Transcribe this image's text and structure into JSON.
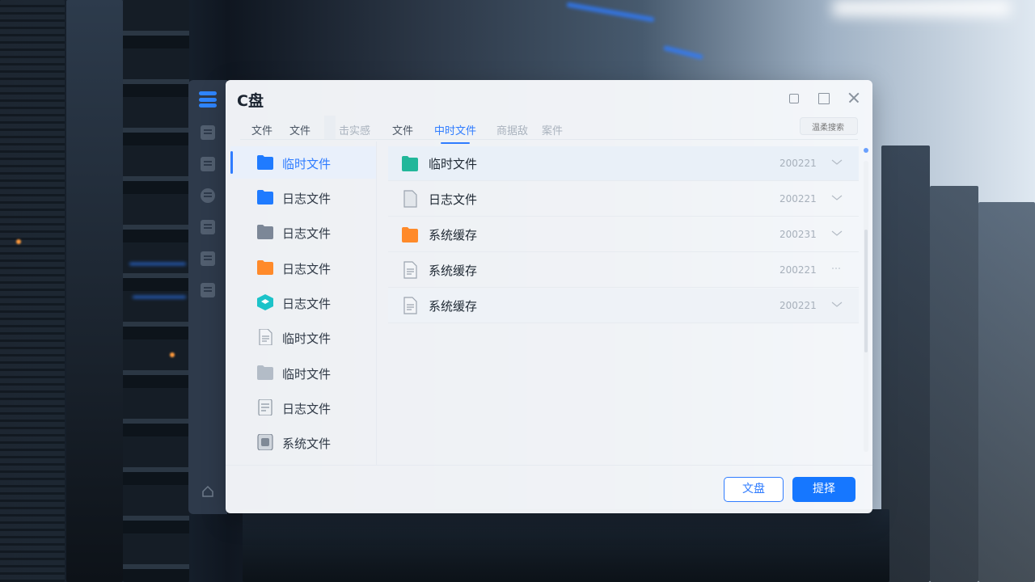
{
  "window": {
    "title": "C盘"
  },
  "tabs": [
    {
      "label": "文件",
      "state": "normal"
    },
    {
      "label": "文件",
      "state": "normal"
    },
    {
      "label": "击实感",
      "state": "muted"
    },
    {
      "label": "文件",
      "state": "normal"
    },
    {
      "label": "中时文件",
      "state": "active"
    },
    {
      "label": "商据敌",
      "state": "muted"
    },
    {
      "label": "案件",
      "state": "muted"
    }
  ],
  "search": {
    "placeholder": "温柔搜索"
  },
  "sidebar": {
    "items": [
      {
        "label": "临时文件",
        "icon": "folder-blue-icon",
        "active": true
      },
      {
        "label": "日志文件",
        "icon": "folder-blue-icon",
        "active": false
      },
      {
        "label": "日志文件",
        "icon": "folder-gray-icon",
        "active": false
      },
      {
        "label": "日志文件",
        "icon": "folder-orange-icon",
        "active": false
      },
      {
        "label": "日志文件",
        "icon": "cube-teal-icon",
        "active": false
      },
      {
        "label": "临时文件",
        "icon": "document-icon",
        "active": false
      },
      {
        "label": "临时文件",
        "icon": "folder-light-gray-icon",
        "active": false
      },
      {
        "label": "日志文件",
        "icon": "document-lines-icon",
        "active": false
      },
      {
        "label": "系统文件",
        "icon": "system-file-icon",
        "active": false
      }
    ]
  },
  "files": [
    {
      "name": "临时文件",
      "date": "200221",
      "icon": "folder-teal-icon",
      "selected": true
    },
    {
      "name": "日志文件",
      "date": "200221",
      "icon": "document-gray-icon",
      "selected": false
    },
    {
      "name": "系统缓存",
      "date": "200231",
      "icon": "folder-orange-icon",
      "selected": false
    },
    {
      "name": "系统缓存",
      "date": "200221",
      "icon": "document-lines-icon",
      "selected": false
    },
    {
      "name": "系统缓存",
      "date": "200221",
      "icon": "document-lines-icon",
      "selected": false,
      "alt": true
    }
  ],
  "buttons": {
    "secondary_label": "文盘",
    "primary_label": "提择"
  },
  "colors": {
    "accent": "#1677ff",
    "strip": "#2e3a4b",
    "folder_blue": "#1f7bff",
    "folder_orange": "#ff8a2a",
    "folder_teal": "#22b79a"
  }
}
